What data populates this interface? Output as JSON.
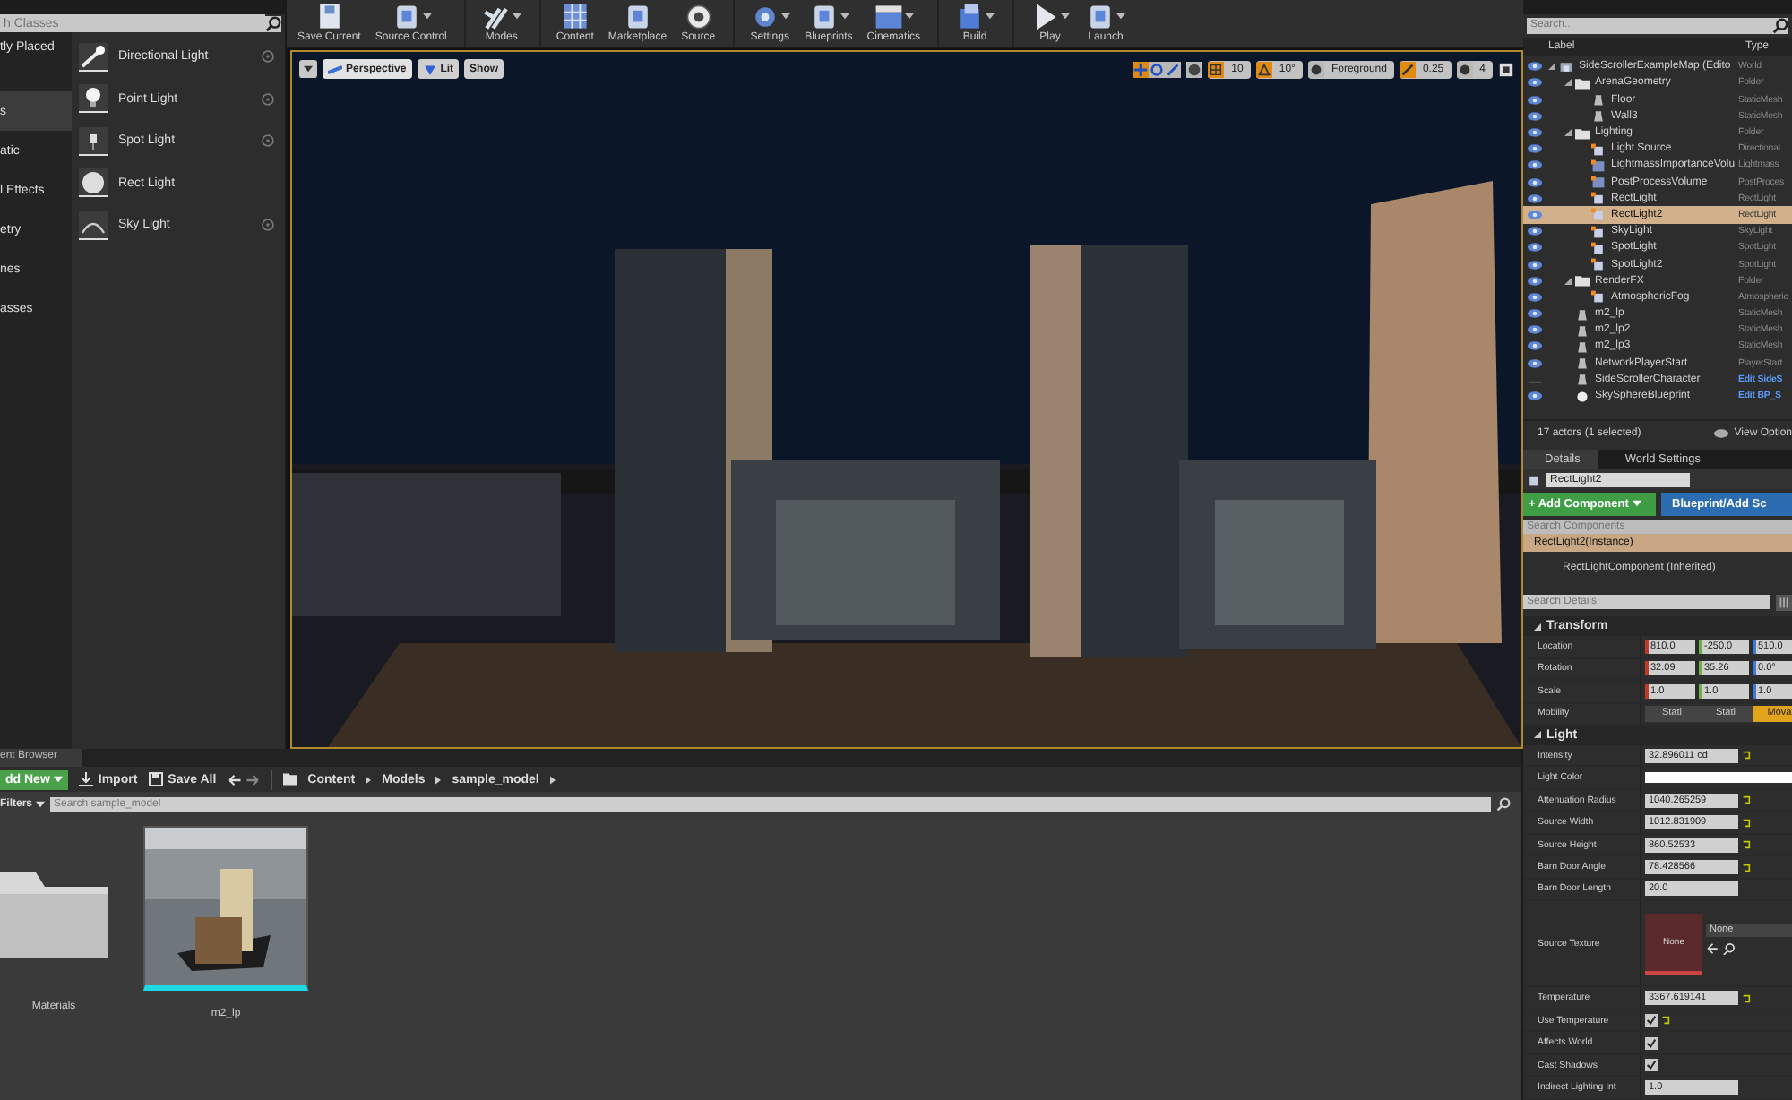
{
  "place_actors": {
    "search": {
      "placeholder": "h Classes"
    },
    "categories": [
      {
        "label": "tly Placed",
        "selected": false
      },
      {
        "label": "s",
        "selected": true
      },
      {
        "label": "atic",
        "selected": false
      },
      {
        "label": "l Effects",
        "selected": false
      },
      {
        "label": "etry",
        "selected": false
      },
      {
        "label": "nes",
        "selected": false
      },
      {
        "label": "asses",
        "selected": false
      }
    ],
    "items": [
      {
        "label": "Directional Light",
        "kind": "directional",
        "help": true
      },
      {
        "label": "Point Light",
        "kind": "point",
        "help": true
      },
      {
        "label": "Spot Light",
        "kind": "spot",
        "help": true
      },
      {
        "label": "Rect Light",
        "kind": "rect",
        "help": false
      },
      {
        "label": "Sky Light",
        "kind": "sky",
        "help": true
      }
    ]
  },
  "toolbar": [
    {
      "label": "Save Current",
      "kind": "save",
      "dropdown": false
    },
    {
      "label": "Source Control",
      "kind": "source-control",
      "dropdown": true
    },
    {
      "label": "Modes",
      "kind": "modes",
      "dropdown": true
    },
    {
      "label": "Content",
      "kind": "content",
      "dropdown": false
    },
    {
      "label": "Marketplace",
      "kind": "marketplace",
      "dropdown": false
    },
    {
      "label": "Source",
      "kind": "source",
      "dropdown": false
    },
    {
      "label": "Settings",
      "kind": "settings",
      "dropdown": true
    },
    {
      "label": "Blueprints",
      "kind": "blueprints",
      "dropdown": true
    },
    {
      "label": "Cinematics",
      "kind": "cinematics",
      "dropdown": true
    },
    {
      "label": "Build",
      "kind": "build",
      "dropdown": true
    },
    {
      "label": "Play",
      "kind": "play",
      "dropdown": true
    },
    {
      "label": "Launch",
      "kind": "launch",
      "dropdown": true
    }
  ],
  "viewport": {
    "buttons": [
      {
        "label": "Perspective",
        "kind": "perspective"
      },
      {
        "label": "Lit",
        "kind": "lit"
      },
      {
        "label": "Show",
        "kind": "plain"
      }
    ],
    "tools": [
      {
        "kind": "move",
        "selected": true
      },
      {
        "kind": "rotate",
        "selected": false
      },
      {
        "kind": "scale",
        "selected": false
      }
    ],
    "snaps": [
      {
        "value": "10",
        "kind": "grid",
        "active": true
      },
      {
        "value": "10°",
        "kind": "rotation",
        "active": true
      },
      {
        "value": "Foreground",
        "kind": "layer",
        "active": false
      },
      {
        "value": "0.25",
        "kind": "scale",
        "active": true
      },
      {
        "value": "4",
        "kind": "camera",
        "active": false
      }
    ]
  },
  "content_browser": {
    "tab": "ent Browser",
    "add_new": "dd New",
    "import": "Import",
    "save_all": "Save All",
    "path": [
      "Content",
      "Models",
      "sample_model"
    ],
    "filters": "Filters",
    "search": {
      "placeholder": "Search sample_model"
    },
    "assets": [
      {
        "label": "Materials",
        "kind": "folder"
      },
      {
        "label": "m2_lp",
        "kind": "mesh"
      }
    ]
  },
  "world_outliner": {
    "search": {
      "placeholder": "Search..."
    },
    "columns": [
      "Label",
      "Type"
    ],
    "rows": [
      {
        "label": "SideScrollerExampleMap (Edito",
        "type": "World",
        "kind": "world",
        "visible": true,
        "selected": false,
        "link": false,
        "expanded": true,
        "children": [
          {
            "label": "ArenaGeometry",
            "type": "Folder",
            "kind": "folder",
            "visible": true,
            "selected": false,
            "link": false,
            "expanded": true,
            "children": [
              {
                "label": "Floor",
                "type": "StaticMesh",
                "kind": "mesh",
                "visible": true,
                "selected": false,
                "link": false
              },
              {
                "label": "Wall3",
                "type": "StaticMesh",
                "kind": "mesh",
                "visible": true,
                "selected": false,
                "link": false
              }
            ]
          },
          {
            "label": "Lighting",
            "type": "Folder",
            "kind": "folder",
            "visible": true,
            "selected": false,
            "link": false,
            "expanded": true,
            "children": [
              {
                "label": "Light Source",
                "type": "Directional",
                "kind": "light",
                "visible": true,
                "selected": false,
                "link": false
              },
              {
                "label": "LightmassImportanceVolu",
                "type": "Lightmass",
                "kind": "volume",
                "visible": true,
                "selected": false,
                "link": false
              },
              {
                "label": "PostProcessVolume",
                "type": "PostProces",
                "kind": "volume",
                "visible": true,
                "selected": false,
                "link": false
              },
              {
                "label": "RectLight",
                "type": "RectLight",
                "kind": "light",
                "visible": true,
                "selected": false,
                "link": false
              },
              {
                "label": "RectLight2",
                "type": "RectLight",
                "kind": "light",
                "visible": true,
                "selected": true,
                "link": false
              },
              {
                "label": "SkyLight",
                "type": "SkyLight",
                "kind": "light",
                "visible": true,
                "selected": false,
                "link": false
              },
              {
                "label": "SpotLight",
                "type": "SpotLight",
                "kind": "light",
                "visible": true,
                "selected": false,
                "link": false
              },
              {
                "label": "SpotLight2",
                "type": "SpotLight",
                "kind": "light",
                "visible": true,
                "selected": false,
                "link": false
              }
            ]
          },
          {
            "label": "RenderFX",
            "type": "Folder",
            "kind": "folder",
            "visible": true,
            "selected": false,
            "link": false,
            "expanded": true,
            "children": [
              {
                "label": "AtmosphericFog",
                "type": "Atmospheric",
                "kind": "light",
                "visible": true,
                "selected": false,
                "link": false
              }
            ]
          },
          {
            "label": "m2_lp",
            "type": "StaticMesh",
            "kind": "mesh",
            "visible": true,
            "selected": false,
            "link": false
          },
          {
            "label": "m2_lp2",
            "type": "StaticMesh",
            "kind": "mesh",
            "visible": true,
            "selected": false,
            "link": false
          },
          {
            "label": "m2_lp3",
            "type": "StaticMesh",
            "kind": "mesh",
            "visible": true,
            "selected": false,
            "link": false
          },
          {
            "label": "NetworkPlayerStart",
            "type": "PlayerStart",
            "kind": "mesh",
            "visible": true,
            "selected": false,
            "link": false
          },
          {
            "label": "SideScrollerCharacter",
            "type": "Edit SideS",
            "kind": "mesh",
            "visible": false,
            "selected": false,
            "link": true
          },
          {
            "label": "SkySphereBlueprint",
            "type": "Edit BP_S",
            "kind": "sphere",
            "visible": true,
            "selected": false,
            "link": true
          }
        ]
      }
    ],
    "status": "17 actors (1 selected)",
    "view_options": "View Option"
  },
  "details": {
    "tabs": [
      {
        "label": "Details",
        "selected": true
      },
      {
        "label": "World Settings",
        "selected": false
      }
    ],
    "name": "RectLight2",
    "add_component": "+ Add Component",
    "blueprint": "Blueprint/Add Sc",
    "component_search": {
      "placeholder": "Search Components"
    },
    "components": [
      {
        "label": "RectLight2(Instance)",
        "selected": true,
        "children": [
          {
            "label": "RectLightComponent (Inherited)",
            "selected": false
          }
        ]
      }
    ],
    "search": {
      "placeholder": "Search Details"
    },
    "sections": [
      {
        "title": "Transform",
        "expanded": true,
        "properties": [
          {
            "kind": "vector",
            "label": "Location",
            "values": [
              "810.0",
              "-250.0",
              "510.0"
            ]
          },
          {
            "kind": "vector",
            "label": "Rotation",
            "values": [
              "32.09",
              "35.26",
              "0.0°"
            ]
          },
          {
            "kind": "vector",
            "label": "Scale",
            "values": [
              "1.0",
              "1.0",
              "1.0"
            ]
          },
          {
            "kind": "options",
            "label": "Mobility",
            "options": [
              {
                "label": "Stati",
                "selected": false
              },
              {
                "label": "Stati",
                "selected": false
              },
              {
                "label": "Mova",
                "selected": true
              }
            ]
          }
        ]
      },
      {
        "title": "Light",
        "expanded": true,
        "properties": [
          {
            "kind": "number",
            "label": "Intensity",
            "value": "32.896011 cd",
            "modified": true
          },
          {
            "kind": "color",
            "label": "Light Color",
            "color": "#ffffff"
          },
          {
            "kind": "number",
            "label": "Attenuation Radius",
            "value": "1040.265259",
            "modified": true
          },
          {
            "kind": "number",
            "label": "Source Width",
            "value": "1012.831909",
            "modified": true
          },
          {
            "kind": "number",
            "label": "Source Height",
            "value": "860.52533",
            "modified": true
          },
          {
            "kind": "number",
            "label": "Barn Door Angle",
            "value": "78.428566",
            "modified": true
          },
          {
            "kind": "number",
            "label": "Barn Door Length",
            "value": "20.0",
            "modified": false
          },
          {
            "kind": "texture",
            "label": "Source Texture",
            "thumbnail": "None",
            "value": "None"
          },
          {
            "kind": "number",
            "label": "Temperature",
            "value": "3367.619141",
            "modified": true
          },
          {
            "kind": "check",
            "label": "Use Temperature",
            "checked": true,
            "modified": true
          },
          {
            "kind": "check",
            "label": "Affects World",
            "checked": true,
            "modified": false
          },
          {
            "kind": "check",
            "label": "Cast Shadows",
            "checked": true,
            "modified": false
          },
          {
            "kind": "number",
            "label": "Indirect Lighting Int",
            "value": "1.0",
            "modified": false
          }
        ]
      }
    ]
  }
}
